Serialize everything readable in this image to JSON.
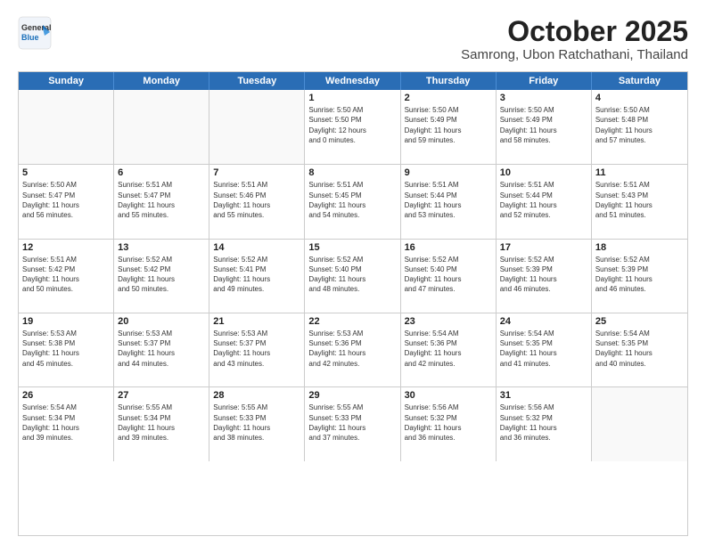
{
  "header": {
    "logo_general": "General",
    "logo_blue": "Blue",
    "month": "October 2025",
    "location": "Samrong, Ubon Ratchathani, Thailand"
  },
  "days_of_week": [
    "Sunday",
    "Monday",
    "Tuesday",
    "Wednesday",
    "Thursday",
    "Friday",
    "Saturday"
  ],
  "weeks": [
    [
      {
        "day": "",
        "info": ""
      },
      {
        "day": "",
        "info": ""
      },
      {
        "day": "",
        "info": ""
      },
      {
        "day": "1",
        "info": "Sunrise: 5:50 AM\nSunset: 5:50 PM\nDaylight: 12 hours\nand 0 minutes."
      },
      {
        "day": "2",
        "info": "Sunrise: 5:50 AM\nSunset: 5:49 PM\nDaylight: 11 hours\nand 59 minutes."
      },
      {
        "day": "3",
        "info": "Sunrise: 5:50 AM\nSunset: 5:49 PM\nDaylight: 11 hours\nand 58 minutes."
      },
      {
        "day": "4",
        "info": "Sunrise: 5:50 AM\nSunset: 5:48 PM\nDaylight: 11 hours\nand 57 minutes."
      }
    ],
    [
      {
        "day": "5",
        "info": "Sunrise: 5:50 AM\nSunset: 5:47 PM\nDaylight: 11 hours\nand 56 minutes."
      },
      {
        "day": "6",
        "info": "Sunrise: 5:51 AM\nSunset: 5:47 PM\nDaylight: 11 hours\nand 55 minutes."
      },
      {
        "day": "7",
        "info": "Sunrise: 5:51 AM\nSunset: 5:46 PM\nDaylight: 11 hours\nand 55 minutes."
      },
      {
        "day": "8",
        "info": "Sunrise: 5:51 AM\nSunset: 5:45 PM\nDaylight: 11 hours\nand 54 minutes."
      },
      {
        "day": "9",
        "info": "Sunrise: 5:51 AM\nSunset: 5:44 PM\nDaylight: 11 hours\nand 53 minutes."
      },
      {
        "day": "10",
        "info": "Sunrise: 5:51 AM\nSunset: 5:44 PM\nDaylight: 11 hours\nand 52 minutes."
      },
      {
        "day": "11",
        "info": "Sunrise: 5:51 AM\nSunset: 5:43 PM\nDaylight: 11 hours\nand 51 minutes."
      }
    ],
    [
      {
        "day": "12",
        "info": "Sunrise: 5:51 AM\nSunset: 5:42 PM\nDaylight: 11 hours\nand 50 minutes."
      },
      {
        "day": "13",
        "info": "Sunrise: 5:52 AM\nSunset: 5:42 PM\nDaylight: 11 hours\nand 50 minutes."
      },
      {
        "day": "14",
        "info": "Sunrise: 5:52 AM\nSunset: 5:41 PM\nDaylight: 11 hours\nand 49 minutes."
      },
      {
        "day": "15",
        "info": "Sunrise: 5:52 AM\nSunset: 5:40 PM\nDaylight: 11 hours\nand 48 minutes."
      },
      {
        "day": "16",
        "info": "Sunrise: 5:52 AM\nSunset: 5:40 PM\nDaylight: 11 hours\nand 47 minutes."
      },
      {
        "day": "17",
        "info": "Sunrise: 5:52 AM\nSunset: 5:39 PM\nDaylight: 11 hours\nand 46 minutes."
      },
      {
        "day": "18",
        "info": "Sunrise: 5:52 AM\nSunset: 5:39 PM\nDaylight: 11 hours\nand 46 minutes."
      }
    ],
    [
      {
        "day": "19",
        "info": "Sunrise: 5:53 AM\nSunset: 5:38 PM\nDaylight: 11 hours\nand 45 minutes."
      },
      {
        "day": "20",
        "info": "Sunrise: 5:53 AM\nSunset: 5:37 PM\nDaylight: 11 hours\nand 44 minutes."
      },
      {
        "day": "21",
        "info": "Sunrise: 5:53 AM\nSunset: 5:37 PM\nDaylight: 11 hours\nand 43 minutes."
      },
      {
        "day": "22",
        "info": "Sunrise: 5:53 AM\nSunset: 5:36 PM\nDaylight: 11 hours\nand 42 minutes."
      },
      {
        "day": "23",
        "info": "Sunrise: 5:54 AM\nSunset: 5:36 PM\nDaylight: 11 hours\nand 42 minutes."
      },
      {
        "day": "24",
        "info": "Sunrise: 5:54 AM\nSunset: 5:35 PM\nDaylight: 11 hours\nand 41 minutes."
      },
      {
        "day": "25",
        "info": "Sunrise: 5:54 AM\nSunset: 5:35 PM\nDaylight: 11 hours\nand 40 minutes."
      }
    ],
    [
      {
        "day": "26",
        "info": "Sunrise: 5:54 AM\nSunset: 5:34 PM\nDaylight: 11 hours\nand 39 minutes."
      },
      {
        "day": "27",
        "info": "Sunrise: 5:55 AM\nSunset: 5:34 PM\nDaylight: 11 hours\nand 39 minutes."
      },
      {
        "day": "28",
        "info": "Sunrise: 5:55 AM\nSunset: 5:33 PM\nDaylight: 11 hours\nand 38 minutes."
      },
      {
        "day": "29",
        "info": "Sunrise: 5:55 AM\nSunset: 5:33 PM\nDaylight: 11 hours\nand 37 minutes."
      },
      {
        "day": "30",
        "info": "Sunrise: 5:56 AM\nSunset: 5:32 PM\nDaylight: 11 hours\nand 36 minutes."
      },
      {
        "day": "31",
        "info": "Sunrise: 5:56 AM\nSunset: 5:32 PM\nDaylight: 11 hours\nand 36 minutes."
      },
      {
        "day": "",
        "info": ""
      }
    ]
  ]
}
